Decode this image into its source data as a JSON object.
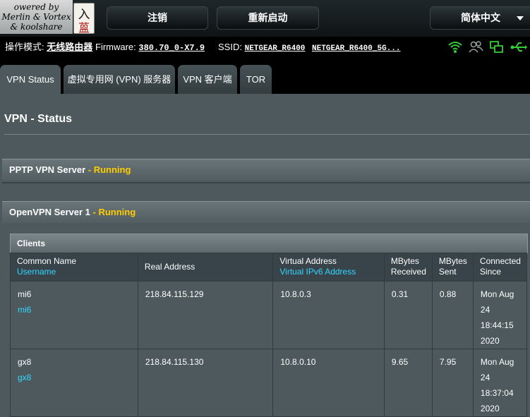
{
  "branding": {
    "line1": "owered by",
    "line2": "Merlin & Vortex",
    "line3": "& koolshare",
    "seal_top": "入",
    "seal_bottom": "蒕"
  },
  "topbar": {
    "logout_label": "注销",
    "reboot_label": "重新启动",
    "language_label": "简体中文"
  },
  "status": {
    "mode_label": "操作模式:",
    "mode_value": "无线路由器",
    "firmware_label": "Firmware:",
    "firmware_value": "380.70_0-X7.9",
    "ssid_label": "SSID:",
    "ssid_1": "NETGEAR_R6400",
    "ssid_2": "NETGEAR_R6400_5G...",
    "icons": [
      "wifi-icon",
      "users-icon",
      "network-icon",
      "usb-icon"
    ],
    "icon_color": "#33cc33"
  },
  "tabs": [
    {
      "label": "VPN Status",
      "active": true
    },
    {
      "label": "虚拟专用网 (VPN) 服务器",
      "active": false
    },
    {
      "label": "VPN 客户端",
      "active": false
    },
    {
      "label": "TOR",
      "active": false
    }
  ],
  "page_title": "VPN - Status",
  "pptp": {
    "title": "PPTP VPN Server",
    "state": " - Running"
  },
  "openvpn": {
    "title": "OpenVPN Server 1",
    "state": " - Running"
  },
  "clients": {
    "title": "Clients",
    "headers": {
      "common_name": "Common Name",
      "username": "Username",
      "real_address": "Real Address",
      "virtual_address": "Virtual Address",
      "virtual_ipv6": "Virtual IPv6 Address",
      "mb_recv_1": "MBytes",
      "mb_recv_2": "Received",
      "mb_sent_1": "MBytes",
      "mb_sent_2": "Sent",
      "since_1": "Connected",
      "since_2": "Since"
    },
    "rows": [
      {
        "name": "mi6",
        "user": "mi6",
        "real": "218.84.115.129",
        "virtual": "10.8.0.3",
        "recv": "0.31",
        "sent": "0.88",
        "since": [
          "Mon Aug",
          "24",
          "18:44:15",
          "2020"
        ]
      },
      {
        "name": "gx8",
        "user": "gx8",
        "real": "218.84.115.130",
        "virtual": "10.8.0.10",
        "recv": "9.65",
        "sent": "7.95",
        "since": [
          "Mon Aug",
          "24",
          "18:37:04",
          "2020"
        ]
      }
    ]
  }
}
